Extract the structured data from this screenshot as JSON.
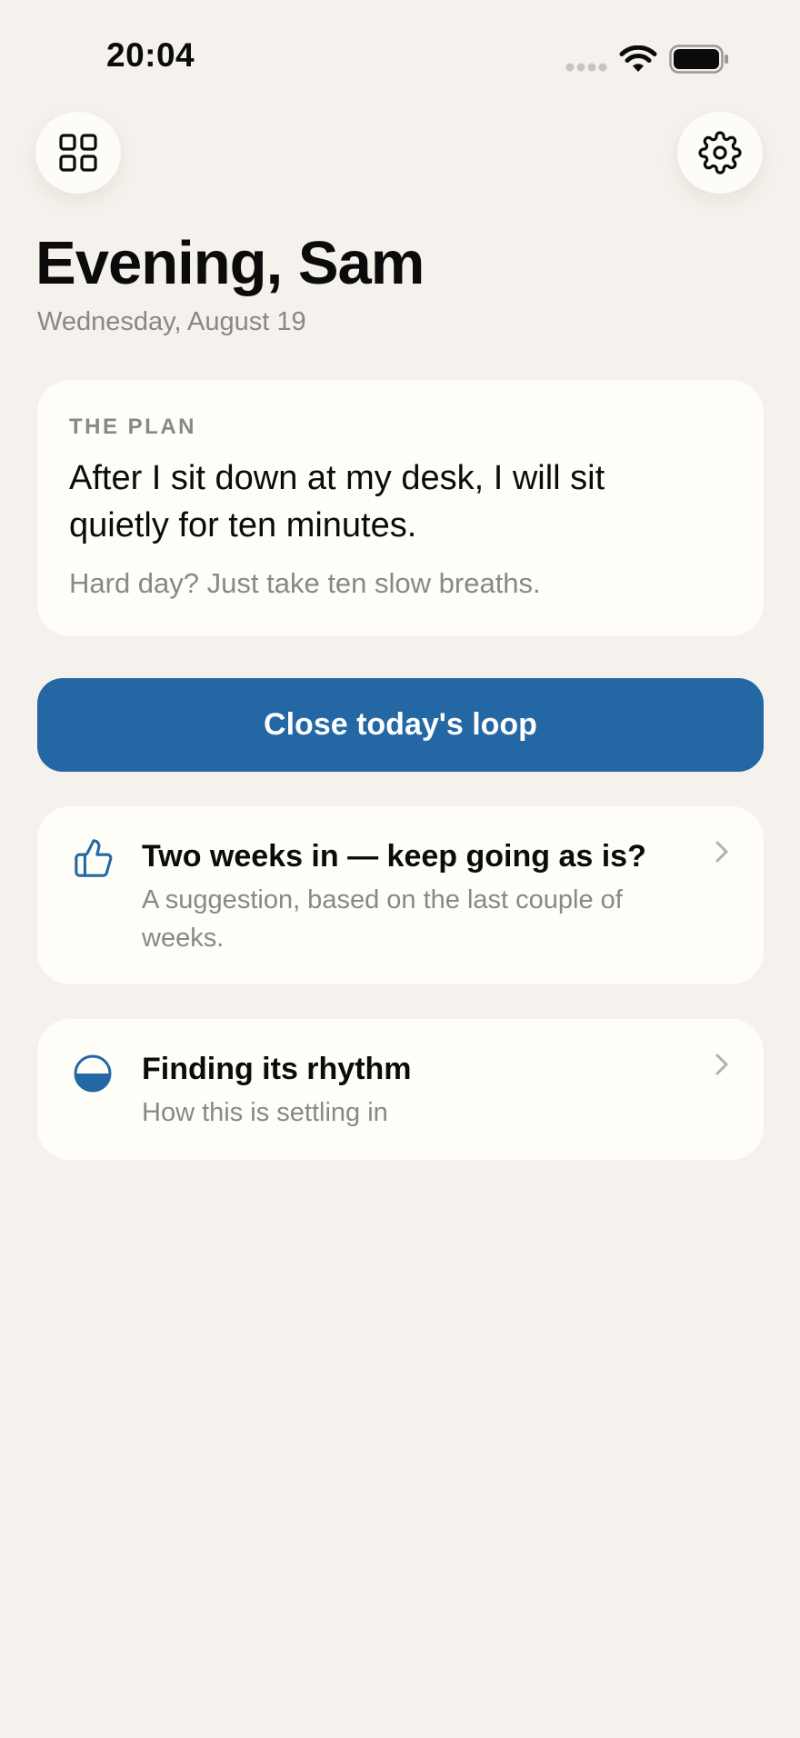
{
  "status_bar": {
    "time": "20:04",
    "icons": [
      "signal-dots-icon",
      "wifi-icon",
      "battery-icon"
    ]
  },
  "header": {
    "left_icon": "grid-icon",
    "right_icon": "gear-icon",
    "greeting": "Evening, Sam",
    "date": "Wednesday, August 19"
  },
  "plan": {
    "label": "THE PLAN",
    "text": "After I sit down at my desk, I will sit quietly for ten minutes.",
    "fallback": "Hard day? Just take ten slow breaths."
  },
  "primary_action": {
    "label": "Close today's loop",
    "color": "#2368a4"
  },
  "suggestion": {
    "icon": "thumbs-up-icon",
    "title": "Two weeks in — keep going as is?",
    "subtitle": "A suggestion, based on the last couple of weeks."
  },
  "rhythm": {
    "icon": "half-circle-icon",
    "title": "Finding its rhythm",
    "subtitle": "How this is settling in",
    "progress": 0.5
  },
  "colors": {
    "background": "#f5f1ec",
    "card": "#fefdf8",
    "accent": "#2368a4",
    "secondary_text": "#8a8884"
  }
}
